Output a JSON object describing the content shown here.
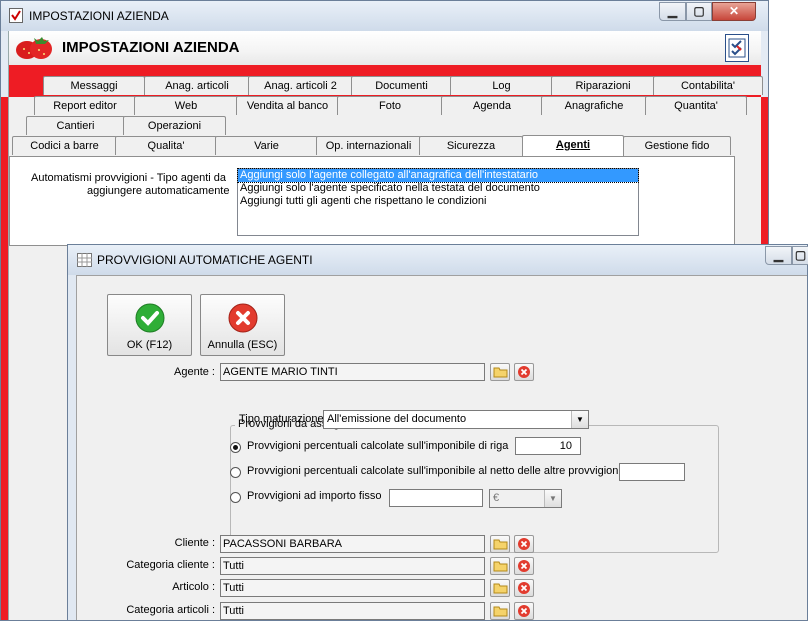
{
  "main_window": {
    "title": "IMPOSTAZIONI AZIENDA",
    "header_title": "IMPOSTAZIONI AZIENDA",
    "tabs_row1": [
      "Messaggi",
      "Anag. articoli",
      "Anag. articoli 2",
      "Documenti",
      "Log",
      "Riparazioni",
      "Contabilita'"
    ],
    "tabs_row2": [
      "Report editor",
      "Web",
      "Vendita al banco",
      "Foto",
      "Agenda",
      "Anagrafiche",
      "Quantita'"
    ],
    "tabs_row3": [
      "Cantieri",
      "Operazioni"
    ],
    "tabs_row4": [
      "Codici a barre",
      "Qualita'",
      "Varie",
      "Op. internazionali",
      "Sicurezza",
      "Agenti",
      "Gestione fido"
    ],
    "selected_tab": "Agenti",
    "agents_label_line1": "Automatismi provvigioni - Tipo agenti da",
    "agents_label_line2": "aggiungere automaticamente",
    "agents_options": [
      "Aggiungi solo l'agente collegato all'anagrafica dell'intestatario",
      "Aggiungi solo l'agente specificato nella testata del documento",
      "Aggiungi tutti gli agenti che rispettano le condizioni"
    ],
    "selected_option_index": 0
  },
  "dialog": {
    "title": "PROVVIGIONI AUTOMATICHE AGENTI",
    "ok_label": "OK (F12)",
    "cancel_label": "Annulla (ESC)",
    "agente_label": "Agente :",
    "agente_value": "AGENTE MARIO TINTI",
    "group_title": "Provvigioni da assegnare",
    "tipo_maturazione_label": "Tipo maturazione :",
    "tipo_maturazione_value": "All'emissione del documento",
    "radio1_label": "Provvigioni percentuali calcolate sull'imponibile di riga",
    "radio1_value": "10",
    "radio2_label": "Provvigioni percentuali calcolate sull'imponibile al netto delle altre provvigioni",
    "radio2_value": "",
    "radio3_label": "Provvigioni ad importo fisso",
    "radio3_value": "",
    "currency_value": "€",
    "selected_radio": 1,
    "cliente_label": "Cliente :",
    "cliente_value": "PACASSONI BARBARA",
    "categoria_cliente_label": "Categoria cliente :",
    "categoria_cliente_value": "Tutti",
    "articolo_label": "Articolo :",
    "articolo_value": "Tutti",
    "categoria_articoli_label": "Categoria articoli :",
    "categoria_articoli_value": "Tutti"
  },
  "colors": {
    "brand_red": "#ee1c24",
    "selection_blue": "#3399ff"
  }
}
